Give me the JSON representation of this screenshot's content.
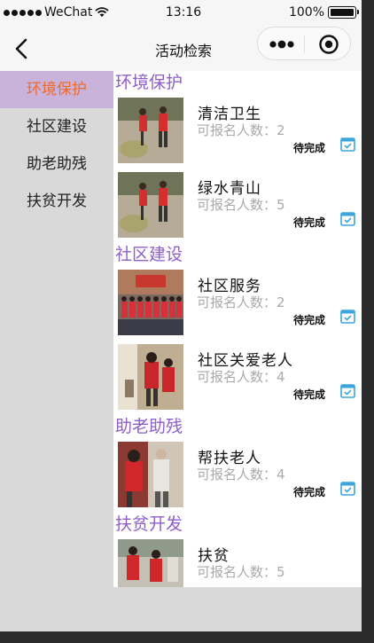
{
  "status_bar": {
    "carrier": "WeChat",
    "time": "13:16",
    "battery": "100%"
  },
  "nav": {
    "title": "活动检索",
    "back_icon": "chevron-left-icon",
    "more_icon": "more-dots-icon",
    "close_icon": "target-close-icon"
  },
  "sidebar": {
    "items": [
      {
        "label": "环境保护",
        "active": true
      },
      {
        "label": "社区建设",
        "active": false
      },
      {
        "label": "助老助残",
        "active": false
      },
      {
        "label": "扶贫开发",
        "active": false
      }
    ]
  },
  "colors": {
    "accent_purple": "#8e5fc8",
    "active_bg": "#c9b3da",
    "active_text": "#f06a2a",
    "sidebar_bg": "#d9d9d9",
    "calendar_blue": "#3aa6dd"
  },
  "sections": [
    {
      "title": "环境保护",
      "cards": [
        {
          "title": "清洁卫生",
          "count_label": "可报名人数：2",
          "status": "待完成"
        },
        {
          "title": "绿水青山",
          "count_label": "可报名人数：5",
          "status": "待完成"
        }
      ]
    },
    {
      "title": "社区建设",
      "cards": [
        {
          "title": "社区服务",
          "count_label": "可报名人数：2",
          "status": "待完成"
        },
        {
          "title": "社区关爱老人",
          "count_label": "可报名人数：4",
          "status": "待完成"
        }
      ]
    },
    {
      "title": "助老助残",
      "cards": [
        {
          "title": "帮扶老人",
          "count_label": "可报名人数：4",
          "status": "待完成"
        }
      ]
    },
    {
      "title": "扶贫开发",
      "cards": [
        {
          "title": "扶贫",
          "count_label": "可报名人数：5",
          "status": ""
        }
      ]
    }
  ]
}
